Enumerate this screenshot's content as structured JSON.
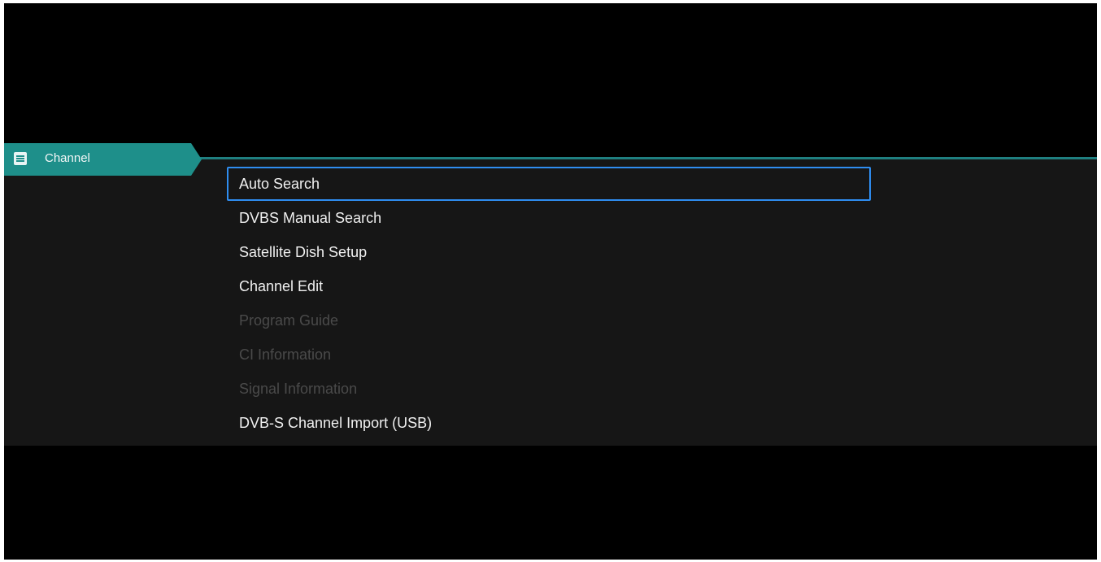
{
  "tab": {
    "icon": "menu-list-icon",
    "label": "Channel"
  },
  "menu": {
    "items": [
      {
        "label": "Auto Search",
        "state": "selected"
      },
      {
        "label": "DVBS Manual Search",
        "state": "enabled"
      },
      {
        "label": "Satellite Dish Setup",
        "state": "enabled"
      },
      {
        "label": "Channel Edit",
        "state": "enabled"
      },
      {
        "label": "Program Guide",
        "state": "disabled"
      },
      {
        "label": "CI Information",
        "state": "disabled"
      },
      {
        "label": "Signal Information",
        "state": "disabled"
      },
      {
        "label": "DVB-S Channel Import (USB)",
        "state": "enabled"
      }
    ]
  },
  "colors": {
    "background": "#000000",
    "panel": "#161616",
    "accent": "#1e8f8a",
    "focus_border": "#2f8df0",
    "text": "#f0f0f0",
    "disabled_text": "#4a4a4a"
  }
}
